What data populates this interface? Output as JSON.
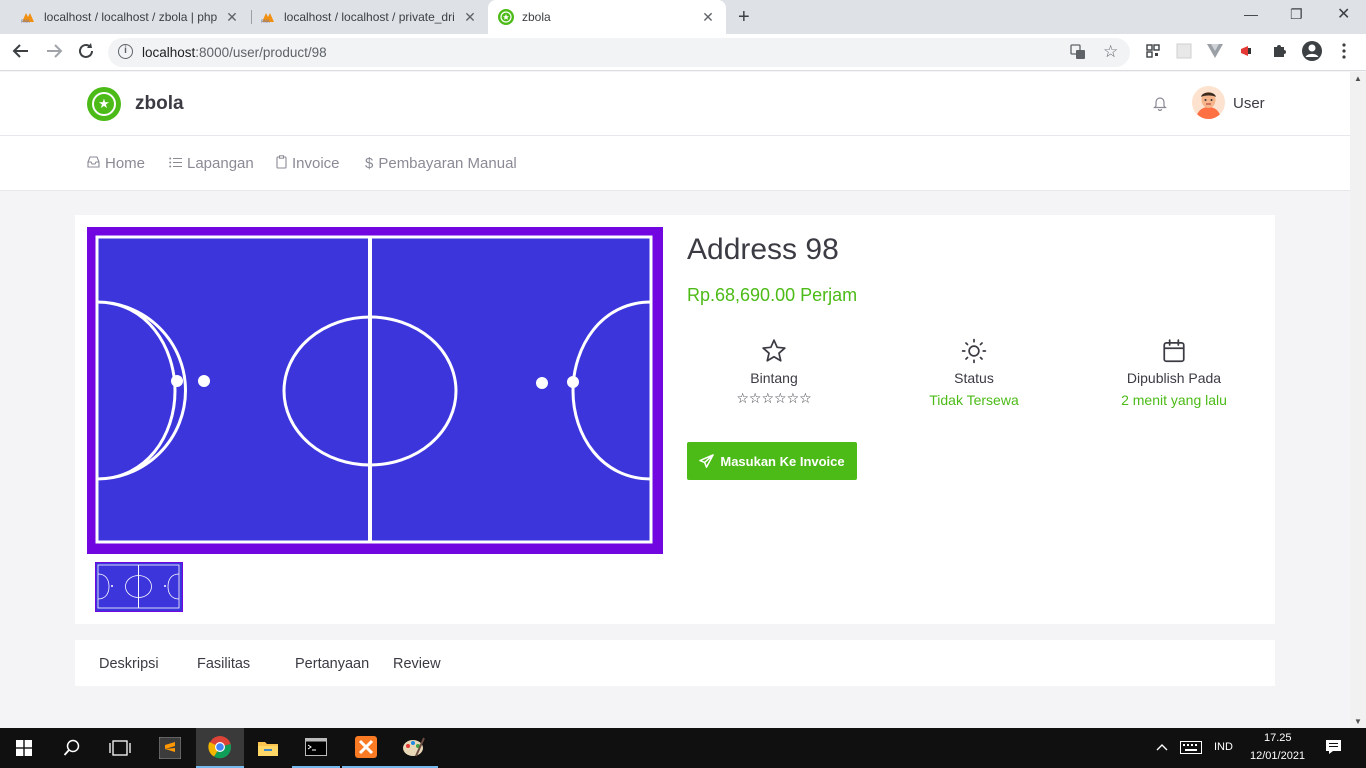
{
  "browser": {
    "tabs": [
      {
        "title": "localhost / localhost / zbola | php",
        "icon": "phpmyadmin-icon"
      },
      {
        "title": "localhost / localhost / private_dri",
        "icon": "phpmyadmin-icon"
      },
      {
        "title": "zbola",
        "icon": "zbola-favicon-icon"
      }
    ],
    "url_host": "localhost",
    "url_path": ":8000/user/product/98"
  },
  "header": {
    "brand": "zbola",
    "user_label": "User"
  },
  "nav": {
    "items": [
      {
        "label": "Home",
        "icon": "inbox-icon"
      },
      {
        "label": "Lapangan",
        "icon": "list-icon"
      },
      {
        "label": "Invoice",
        "icon": "clipboard-icon"
      },
      {
        "label": "Pembayaran Manual",
        "icon": "dollar-icon"
      }
    ]
  },
  "product": {
    "title": "Address 98",
    "price": "Rp.68,690.00 Perjam",
    "stats": [
      {
        "label": "Bintang",
        "icon": "star-icon",
        "rating": 0,
        "max": 6
      },
      {
        "label": "Status",
        "value": "Tidak Tersewa",
        "icon": "sun-icon"
      },
      {
        "label": "Dipublish Pada",
        "value": "2 menit yang lalu",
        "icon": "calendar-icon"
      }
    ],
    "button_label": "Masukan Ke Invoice"
  },
  "tabs": [
    "Deskripsi",
    "Fasilitas",
    "Pertanyaan",
    "Review"
  ],
  "taskbar": {
    "lang": "IND",
    "time": "17.25",
    "date": "12/01/2021"
  },
  "colors": {
    "accent_green": "#4cbb17",
    "court_border": "#7206e0",
    "court_field": "#3c35dc"
  }
}
